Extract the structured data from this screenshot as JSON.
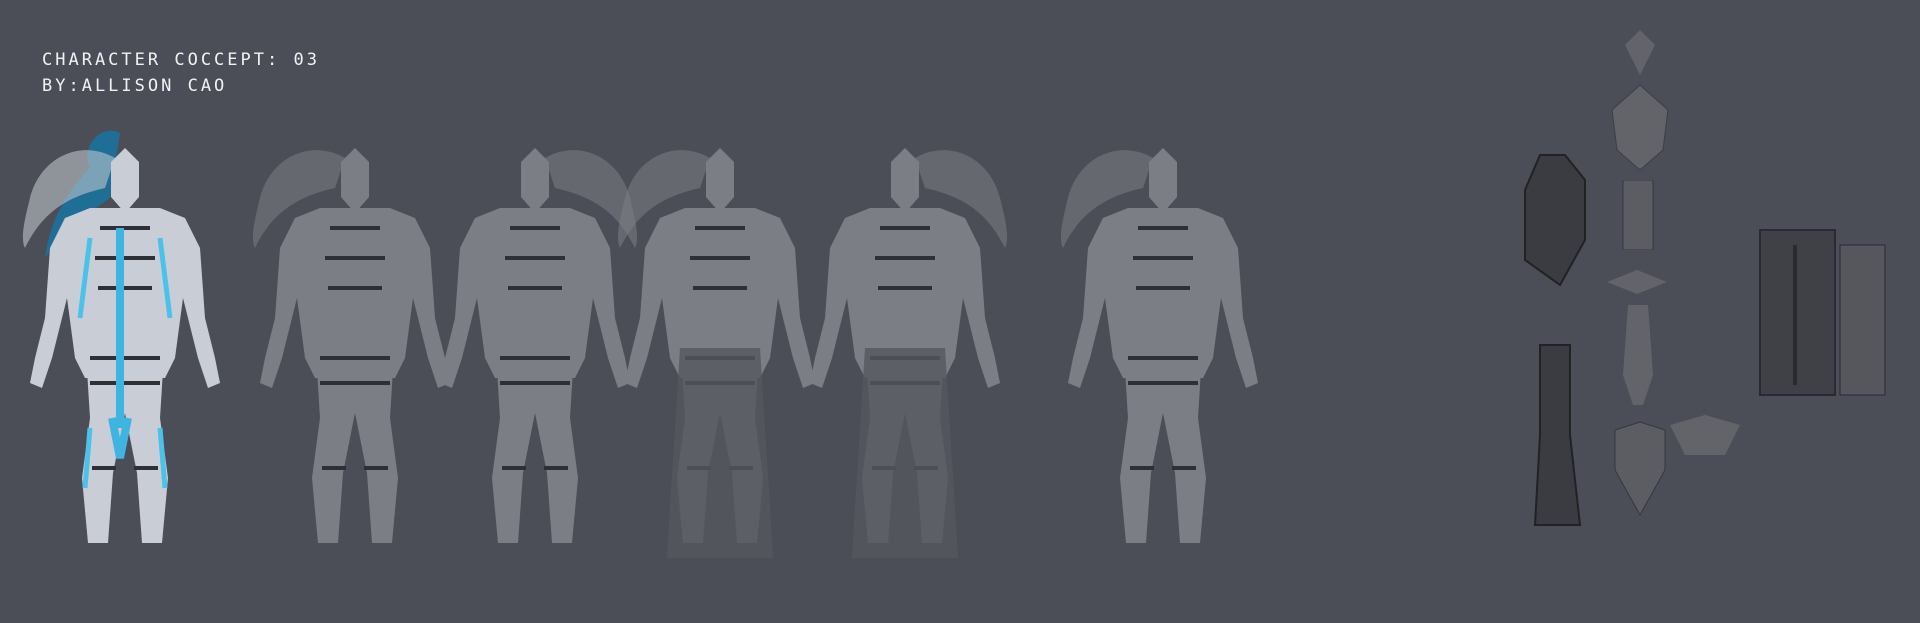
{
  "sheet": {
    "title": "CHARACTER COCCEPT: 03",
    "author": "BY:ALLISON CAO"
  }
}
